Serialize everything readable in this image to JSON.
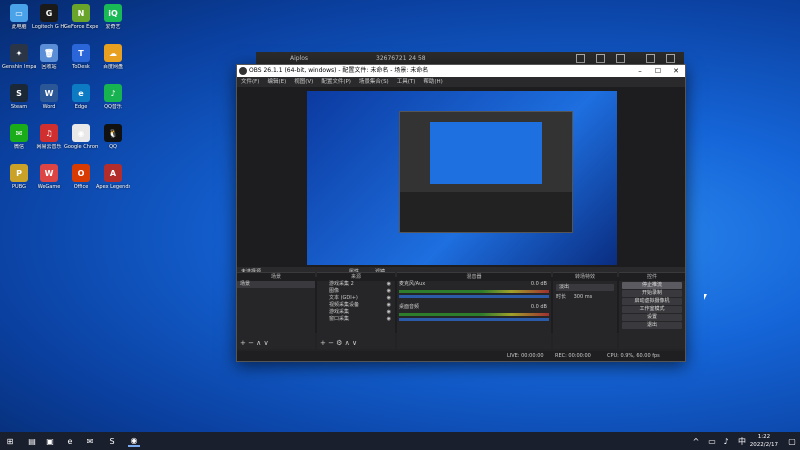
{
  "desktop": {
    "icons": [
      {
        "label": "此电脑",
        "color": "#4aa3e8",
        "glyph": "▭"
      },
      {
        "label": "Logitech G HUB",
        "color": "#1a1a1a",
        "glyph": "G"
      },
      {
        "label": "GeForce Experience",
        "color": "#6aa52b",
        "glyph": "N"
      },
      {
        "label": "爱奇艺",
        "color": "#19b955",
        "glyph": "iQ"
      },
      {
        "label": "Genshin Impact",
        "color": "#2b3548",
        "glyph": "✦"
      },
      {
        "label": "回收站",
        "color": "#5a8fd8",
        "glyph": "🗑"
      },
      {
        "label": "ToDesk",
        "color": "#2a66d8",
        "glyph": "T"
      },
      {
        "label": "百度网盘",
        "color": "#e8a020",
        "glyph": "☁"
      },
      {
        "label": "Steam",
        "color": "#1b2838",
        "glyph": "S"
      },
      {
        "label": "Word",
        "color": "#2b5797",
        "glyph": "W"
      },
      {
        "label": "Edge",
        "color": "#0d7ac4",
        "glyph": "e"
      },
      {
        "label": "QQ音乐",
        "color": "#17b350",
        "glyph": "♪"
      },
      {
        "label": "微信",
        "color": "#1aad19",
        "glyph": "✉"
      },
      {
        "label": "网易云音乐",
        "color": "#d02f2f",
        "glyph": "♫"
      },
      {
        "label": "Google Chrome",
        "color": "#e8e8e8",
        "glyph": "◉"
      },
      {
        "label": "QQ",
        "color": "#111",
        "glyph": "🐧"
      },
      {
        "label": "PUBG",
        "color": "#c9a227",
        "glyph": "P"
      },
      {
        "label": "WeGame",
        "color": "#d44",
        "glyph": "W"
      },
      {
        "label": "Office",
        "color": "#d83b01",
        "glyph": "O"
      },
      {
        "label": "Apex Legends",
        "color": "#b32d2d",
        "glyph": "A"
      }
    ]
  },
  "background_window": {
    "title": "Aiplos",
    "stats": "32676721    24    58"
  },
  "obs": {
    "title": "OBS 26.1.1 (64-bit, windows) - 配置文件: 未命名 - 场景: 未命名",
    "menu": [
      "文件(F)",
      "编辑(E)",
      "视图(V)",
      "配置文件(P)",
      "场景集合(S)",
      "工具(T)",
      "帮助(H)"
    ],
    "no_source": "未选择源",
    "props_btn": "属性",
    "filter_btn": "滤镜",
    "docks": {
      "scenes": {
        "header": "场景",
        "items": [
          "场景"
        ]
      },
      "sources": {
        "header": "来源",
        "items": [
          "游戏采集 2",
          "图像",
          "文本 (GDI+)",
          "视频采集设备",
          "游戏采集",
          "窗口采集"
        ]
      },
      "mixer": {
        "header": "混音器",
        "ch1": "麦克风/Aux",
        "ch1_db": "0.0 dB",
        "ch2": "桌面音频",
        "ch2_db": "0.0 dB"
      },
      "transitions": {
        "header": "转场特效",
        "type": "淡出",
        "duration_label": "时长",
        "duration": "300 ms"
      },
      "controls": {
        "header": "控件",
        "buttons": [
          "停止推流",
          "开始录制",
          "启动虚拟摄像机",
          "工作室模式",
          "设置",
          "退出"
        ]
      }
    },
    "status": {
      "live": "LIVE: 00:00:00",
      "rec": "REC: 00:00:00",
      "cpu": "CPU: 0.9%, 60.00 fps"
    }
  },
  "taskbar": {
    "time": "1:22",
    "date": "2022/2/17"
  }
}
